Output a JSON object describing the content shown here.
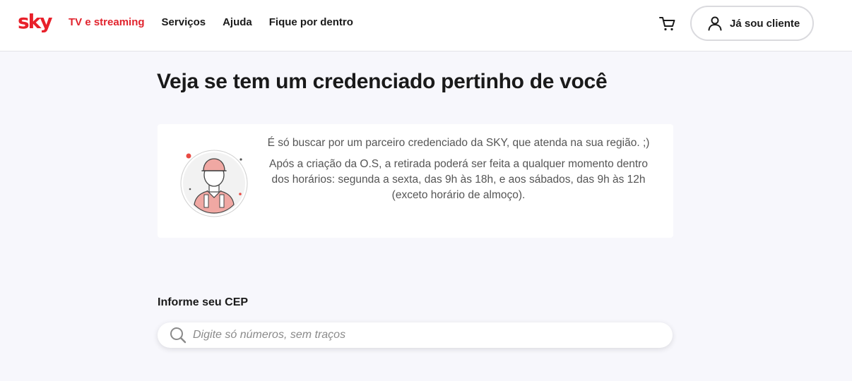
{
  "header": {
    "logo_text": "sky",
    "nav": [
      {
        "label": "TV e streaming",
        "active": true
      },
      {
        "label": "Serviços",
        "active": false
      },
      {
        "label": "Ajuda",
        "active": false
      },
      {
        "label": "Fique por dentro",
        "active": false
      }
    ],
    "login_label": "Já sou cliente"
  },
  "main": {
    "title": "Veja se tem um credenciado pertinho de você",
    "info": {
      "line1": "É só buscar por um parceiro credenciado da SKY, que atenda na sua região. ;)",
      "line2": "Após a criação da O.S, a retirada poderá ser feita a qualquer momento dentro dos horários: segunda a sexta, das 9h às 18h, e aos sábados, das 9h às 12h (exceto horário de almoço)."
    },
    "cep": {
      "label": "Informe seu CEP",
      "placeholder": "Digite só números, sem traços",
      "value": ""
    }
  },
  "icons": {
    "cart": "cart-icon",
    "user": "user-icon",
    "search": "search-icon",
    "technician": "technician-illustration"
  },
  "colors": {
    "brand_red": "#e1232d",
    "background": "#f7f7fc",
    "card": "#ffffff",
    "illustration_pink": "#f0a8a3"
  }
}
